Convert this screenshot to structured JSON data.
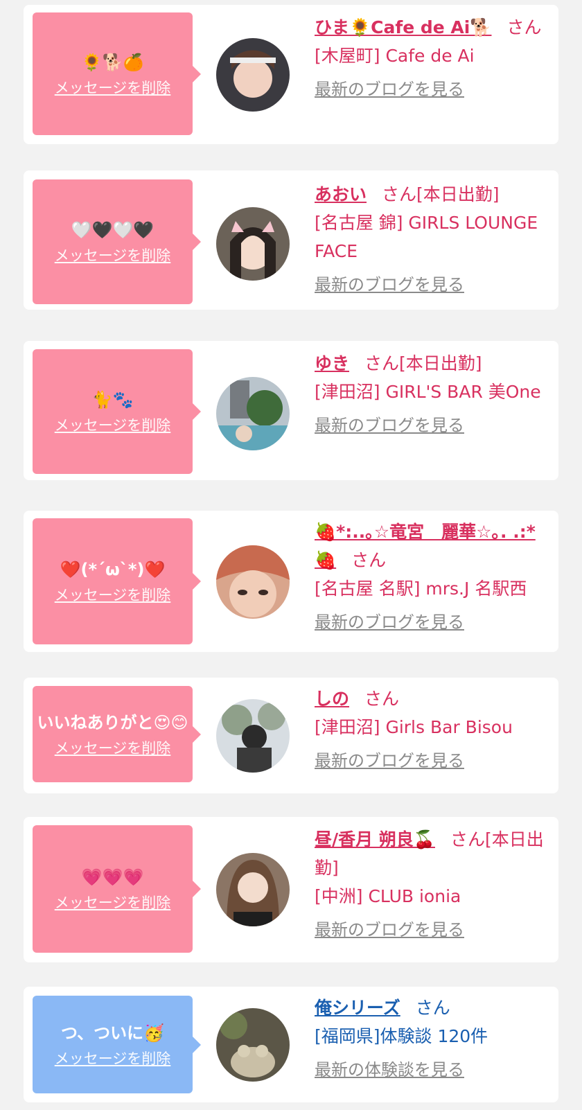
{
  "delete_label": "メッセージを削除",
  "san_label": "さん",
  "cards": [
    {
      "message": "🌻🐕🍊",
      "name": "ひま🌻Cafe de Ai🐕",
      "tag": "",
      "shop": "[木屋町] Cafe de Ai",
      "link": "最新のブログを見る",
      "bubble_color": "#fb8fa4"
    },
    {
      "message": "🤍🖤🤍🖤",
      "name": "あおい",
      "tag": "[本日出勤]",
      "shop": "[名古屋 錦] GIRLS LOUNGE FACE",
      "link": "最新のブログを見る",
      "bubble_color": "#fb8fa4"
    },
    {
      "message": "🐈🐾",
      "name": "ゆき",
      "tag": "[本日出勤]",
      "shop": "[津田沼] GIRL'S BAR 美One",
      "link": "最新のブログを見る",
      "bubble_color": "#fb8fa4"
    },
    {
      "message": "❤️(*´ω`*)❤️",
      "name": "🍓*:..｡☆竜宮　麗華☆｡. .:*🍓",
      "tag": "",
      "shop": "[名古屋 名駅] mrs.J 名駅西",
      "link": "最新のブログを見る",
      "bubble_color": "#fb8fa4"
    },
    {
      "message": "いいねありがと😍😊",
      "name": "しの",
      "tag": "",
      "shop": "[津田沼] Girls Bar Bisou",
      "link": "最新のブログを見る",
      "bubble_color": "#fb8fa4"
    },
    {
      "message": "💗💗💗",
      "name": "昼/香月 朔良🍒",
      "tag": "[本日出勤]",
      "shop": "[中洲] CLUB ionia",
      "link": "最新のブログを見る",
      "bubble_color": "#fb8fa4"
    },
    {
      "message": "つ、ついに🥳",
      "name": "俺シリーズ",
      "tag": "",
      "shop": "[福岡県]体験談 120件",
      "link": "最新の体験談を見る",
      "bubble_color": "#8ab8f5"
    }
  ],
  "avatar_icons": [
    "avatar-photo",
    "avatar-photo",
    "avatar-photo",
    "avatar-photo",
    "avatar-photo",
    "avatar-photo",
    "avatar-photo"
  ]
}
